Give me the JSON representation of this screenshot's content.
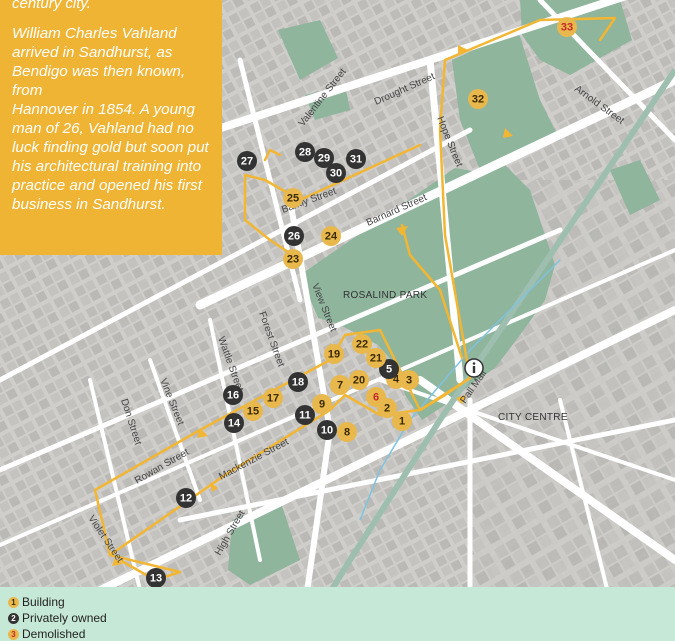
{
  "callout": {
    "top_text": "century city.",
    "text": "William Charles Vahland\narrived in Sandhurst, as\nBendigo was then known, from\nHannover in 1854. A young\nman of 26, Vahland had no\nluck finding gold but soon put\nhis architectural training into\npractice and opened his first\nbusiness in Sandhurst."
  },
  "areas": {
    "park": "ROSALIND PARK",
    "centre": "CITY CENTRE"
  },
  "streets": {
    "valentine": "Valentine Street",
    "drought": "Drought Street",
    "hope": "Hope Street",
    "arnold": "Arnold Street",
    "barkly": "Barkly Street",
    "barnard": "Barnard Street",
    "view": "View Street",
    "forest": "Forest Street",
    "wattle": "Wattle Street",
    "vine": "Vine Street",
    "don": "Don Street",
    "rowan": "Rowan Street",
    "mackenzie": "Mackenzie Street",
    "pall_mall": "Pall Mall",
    "violet": "Violet Street",
    "high": "High Street"
  },
  "info_icon": "info-icon",
  "colors": {
    "building": "#e8b84d",
    "private": "#333333",
    "demolished_text": "#c62828",
    "route": "#f2b632",
    "park": "#8fb59d",
    "legend_bg": "#c6e8d6",
    "callout_bg": "#f0b435"
  },
  "legend": [
    {
      "num": "1",
      "label": "Building",
      "type": "building"
    },
    {
      "num": "2",
      "label": "Privately owned",
      "type": "private"
    },
    {
      "num": "3",
      "label": "Demolished",
      "type": "demolished"
    }
  ],
  "markers": [
    {
      "num": "1",
      "type": "building"
    },
    {
      "num": "2",
      "type": "building"
    },
    {
      "num": "3",
      "type": "building"
    },
    {
      "num": "4",
      "type": "building"
    },
    {
      "num": "5",
      "type": "private"
    },
    {
      "num": "6",
      "type": "demolished"
    },
    {
      "num": "7",
      "type": "building"
    },
    {
      "num": "8",
      "type": "building"
    },
    {
      "num": "9",
      "type": "building"
    },
    {
      "num": "10",
      "type": "private"
    },
    {
      "num": "11",
      "type": "private"
    },
    {
      "num": "12",
      "type": "private"
    },
    {
      "num": "13",
      "type": "private"
    },
    {
      "num": "14",
      "type": "private"
    },
    {
      "num": "15",
      "type": "building"
    },
    {
      "num": "16",
      "type": "private"
    },
    {
      "num": "17",
      "type": "building"
    },
    {
      "num": "18",
      "type": "private"
    },
    {
      "num": "19",
      "type": "building"
    },
    {
      "num": "20",
      "type": "building"
    },
    {
      "num": "21",
      "type": "building"
    },
    {
      "num": "22",
      "type": "building"
    },
    {
      "num": "23",
      "type": "building"
    },
    {
      "num": "24",
      "type": "building"
    },
    {
      "num": "25",
      "type": "building"
    },
    {
      "num": "26",
      "type": "private"
    },
    {
      "num": "27",
      "type": "private"
    },
    {
      "num": "28",
      "type": "private"
    },
    {
      "num": "29",
      "type": "private"
    },
    {
      "num": "30",
      "type": "private"
    },
    {
      "num": "31",
      "type": "private"
    },
    {
      "num": "32",
      "type": "building"
    },
    {
      "num": "33",
      "type": "demolished"
    }
  ]
}
